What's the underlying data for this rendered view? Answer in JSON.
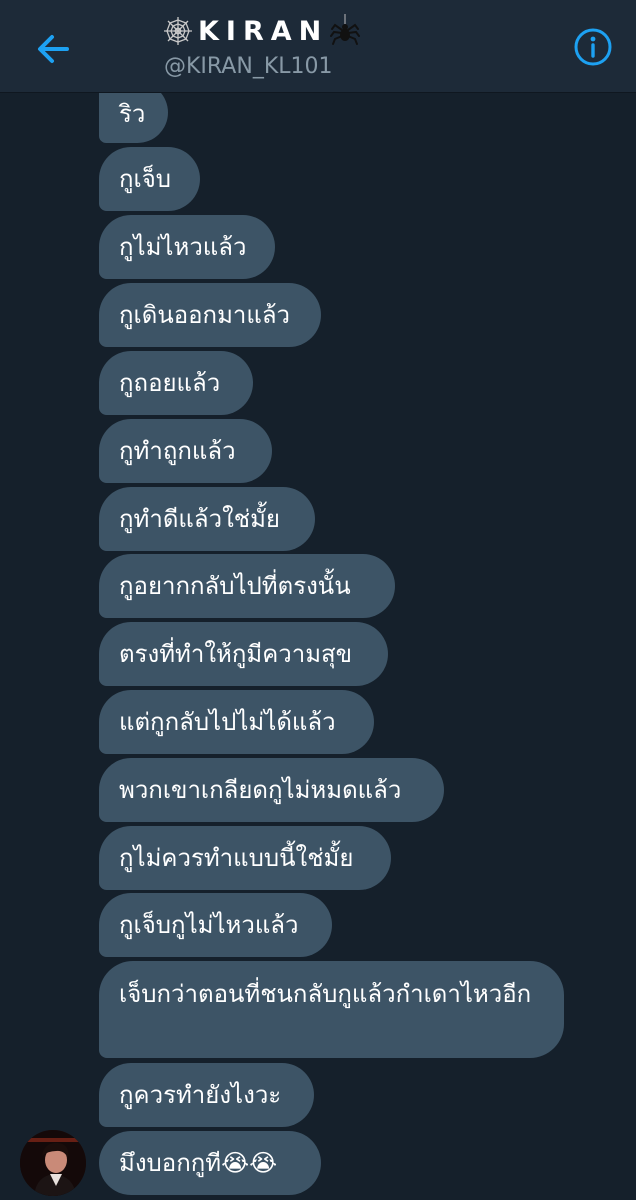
{
  "header": {
    "name": "KIRAN",
    "handle": "@KIRAN_KL101",
    "back_icon": "arrow-left-icon",
    "info_icon": "info-icon",
    "accent_color": "#1da1f2"
  },
  "messages": [
    "ริว",
    "กูเจ็บ",
    "กูไม่ไหวแล้ว",
    "กูเดินออกมาแล้ว",
    "กูถอยแล้ว",
    "กูทำถูกแล้ว",
    "กูทำดีแล้วใช่มั้ย",
    "กูอยากกลับไปที่ตรงนั้น",
    "ตรงที่ทำให้กูมีความสุข",
    "แต่กูกลับไปไม่ได้แล้ว",
    "พวกเขาเกลียดกูไม่หมดแล้ว",
    "กูไม่ควรทำแบบนี้ใช่มั้ย",
    "กูเจ็บกูไม่ไหวแล้ว",
    "เจ็บกว่าตอนที่ชนกลับกูแล้วกำเดาไหวอีก",
    "กูควรทำยังไงวะ",
    "มึงบอกกูที😭😭"
  ],
  "colors": {
    "background": "#15202b",
    "header": "#1d2a38",
    "bubble": "#3d5466"
  }
}
